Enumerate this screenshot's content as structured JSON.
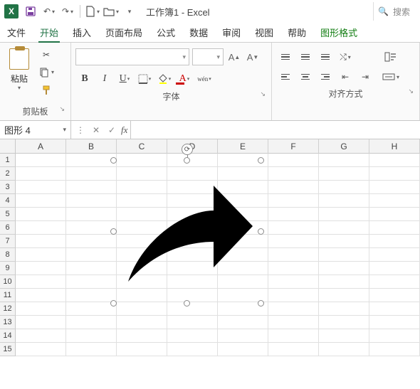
{
  "titlebar": {
    "app_char": "X",
    "title": "工作簿1 - Excel",
    "search_placeholder": "搜索"
  },
  "tabs": {
    "file": "文件",
    "home": "开始",
    "insert": "插入",
    "page_layout": "页面布局",
    "formulas": "公式",
    "data": "数据",
    "review": "审阅",
    "view": "视图",
    "help": "帮助",
    "shape_format": "图形格式"
  },
  "ribbon": {
    "clipboard": {
      "paste": "粘贴",
      "group_label": "剪贴板"
    },
    "font": {
      "group_label": "字体",
      "wen": "wén"
    },
    "align": {
      "group_label": "对齐方式"
    }
  },
  "name_box": {
    "value": "图形 4"
  },
  "fx": {
    "label": "fx"
  },
  "columns": [
    "A",
    "B",
    "C",
    "D",
    "E",
    "F",
    "G",
    "H"
  ],
  "rows": [
    "1",
    "2",
    "3",
    "4",
    "5",
    "6",
    "7",
    "8",
    "9",
    "10",
    "11",
    "12",
    "13",
    "14",
    "15"
  ]
}
